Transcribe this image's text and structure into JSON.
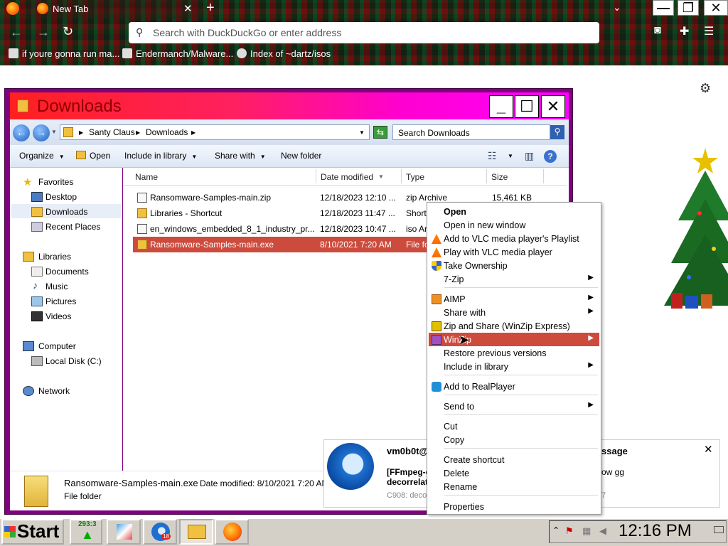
{
  "browser": {
    "tab_title": "New Tab",
    "address_placeholder": "Search with DuckDuckGo or enter address",
    "bookmarks": [
      "if youre gonna run ma...",
      "Endermanch/Malware...",
      "Index of ~dartz/isos"
    ]
  },
  "explorer": {
    "title": "Downloads",
    "breadcrumb": [
      "Santy Claus",
      "Downloads"
    ],
    "search_placeholder": "Search Downloads",
    "commands": {
      "organize": "Organize",
      "open": "Open",
      "include": "Include in library",
      "share": "Share with",
      "new_folder": "New folder"
    },
    "nav": {
      "favorites": "Favorites",
      "desktop": "Desktop",
      "downloads": "Downloads",
      "recent": "Recent Places",
      "libraries": "Libraries",
      "documents": "Documents",
      "music": "Music",
      "pictures": "Pictures",
      "videos": "Videos",
      "computer": "Computer",
      "local_disk": "Local Disk (C:)",
      "network": "Network"
    },
    "columns": {
      "name": "Name",
      "date": "Date modified",
      "type": "Type",
      "size": "Size"
    },
    "files": [
      {
        "name": "Ransomware-Samples-main.zip",
        "date": "12/18/2023 12:10 ...",
        "type": "zip Archive",
        "size": "15,461 KB"
      },
      {
        "name": "Libraries - Shortcut",
        "date": "12/18/2023 11:47 ...",
        "type": "Short",
        "size": ""
      },
      {
        "name": "en_windows_embedded_8_1_industry_pr...",
        "date": "12/18/2023 10:47 ...",
        "type": "iso Ar",
        "size": ""
      },
      {
        "name": "Ransomware-Samples-main.exe",
        "date": "8/10/2021 7:20 AM",
        "type": "File fo",
        "size": ""
      }
    ],
    "details": {
      "name": "Ransomware-Samples-main.exe",
      "modified": "Date modified: 8/10/2021 7:20 AM",
      "kind": "File folder"
    }
  },
  "context_menu": {
    "items": [
      "Open",
      "Open in new window",
      "Add to VLC media player's Playlist",
      "Play with VLC media player",
      "Take Ownership",
      "7-Zip",
      "AIMP",
      "Share with",
      "Zip and Share (WinZip Express)",
      "WinZip",
      "Restore previous versions",
      "Include in library",
      "Add to RealPlayer",
      "Send to",
      "Cut",
      "Copy",
      "Create shortcut",
      "Delete",
      "Rename",
      "Properties"
    ]
  },
  "notification": {
    "sender": "vm0b0t@",
    "subject_1": "[FFmpeg-d",
    "subject_2": "decorrelat",
    "preview": "C908: deco",
    "right_title": "ssage",
    "right_text": "ow gg",
    "right_digit": "7"
  },
  "taskbar": {
    "start_label": "Start",
    "tree_badge": "293:3",
    "thunderbird_badge": "18",
    "clock": "12:16 PM"
  }
}
